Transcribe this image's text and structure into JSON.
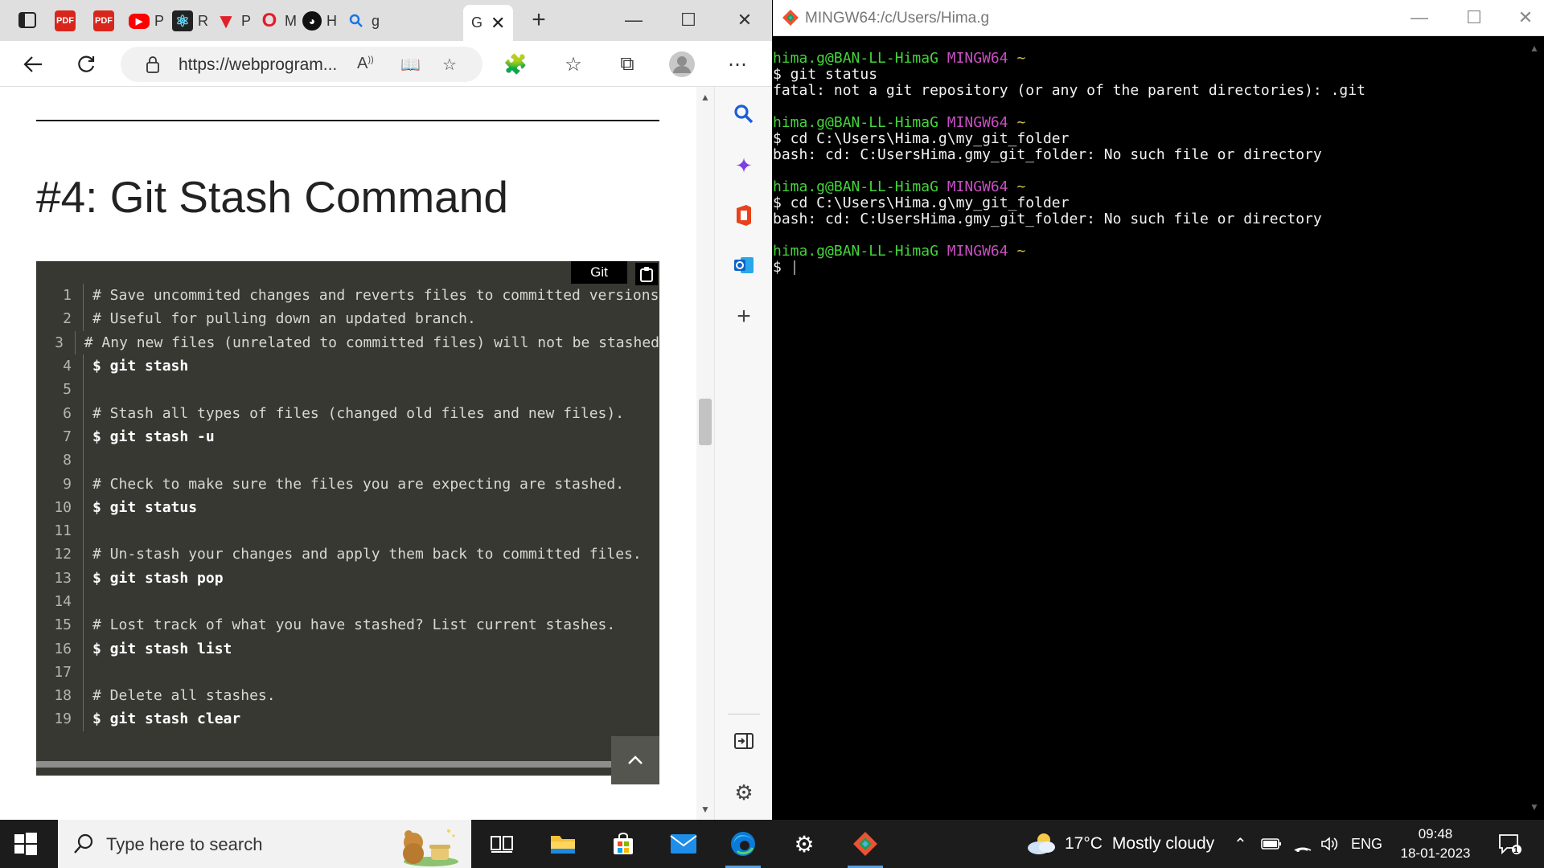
{
  "browser": {
    "tabs": [
      {
        "label": "P",
        "icon": "pdf-icon"
      },
      {
        "label": "P",
        "icon": "youtube-icon"
      },
      {
        "label": "R",
        "icon": "react-icon"
      },
      {
        "label": "P",
        "icon": "v-icon"
      },
      {
        "label": "M",
        "icon": "opera-icon"
      },
      {
        "label": "H",
        "icon": "github-icon"
      },
      {
        "label": "g",
        "icon": "search-icon"
      },
      {
        "label": "G",
        "icon": "page-icon"
      }
    ],
    "url": "https://webprogram...",
    "heading": "#4: Git Stash Command",
    "code_lang": "Git",
    "code_lines": [
      {
        "n": "1",
        "text": "# Save uncommited changes and reverts files to committed versions",
        "cmd": false
      },
      {
        "n": "2",
        "text": "# Useful for pulling down an updated branch.",
        "cmd": false
      },
      {
        "n": "3",
        "text": "# Any new files (unrelated to committed files) will not be stashed",
        "cmd": false
      },
      {
        "n": "4",
        "text": "$ git stash",
        "cmd": true
      },
      {
        "n": "5",
        "text": "",
        "cmd": false
      },
      {
        "n": "6",
        "text": "# Stash all types of files (changed old files and new files).",
        "cmd": false
      },
      {
        "n": "7",
        "text": "$ git stash -u",
        "cmd": true
      },
      {
        "n": "8",
        "text": "",
        "cmd": false
      },
      {
        "n": "9",
        "text": "# Check to make sure the files you are expecting are stashed.",
        "cmd": false
      },
      {
        "n": "10",
        "text": "$ git status",
        "cmd": true
      },
      {
        "n": "11",
        "text": "",
        "cmd": false
      },
      {
        "n": "12",
        "text": "# Un-stash your changes and apply them back to committed files.",
        "cmd": false
      },
      {
        "n": "13",
        "text": "$ git stash pop",
        "cmd": true
      },
      {
        "n": "14",
        "text": "",
        "cmd": false
      },
      {
        "n": "15",
        "text": "# Lost track of what you have stashed? List current stashes.",
        "cmd": false
      },
      {
        "n": "16",
        "text": "$ git stash list",
        "cmd": true
      },
      {
        "n": "17",
        "text": "",
        "cmd": false
      },
      {
        "n": "18",
        "text": "# Delete all stashes.",
        "cmd": false
      },
      {
        "n": "19",
        "text": "$ git stash clear",
        "cmd": true
      }
    ]
  },
  "terminal": {
    "title": "MINGW64:/c/Users/Hima.g",
    "prompt_user": "hima.g@BAN-LL-HimaG",
    "prompt_host": "MINGW64",
    "prompt_dir": "~",
    "lines": [
      {
        "type": "prompt"
      },
      {
        "type": "text",
        "text": "$ git status"
      },
      {
        "type": "text",
        "text": "fatal: not a git repository (or any of the parent directories): .git"
      },
      {
        "type": "blank"
      },
      {
        "type": "prompt"
      },
      {
        "type": "text",
        "text": "$ cd C:\\Users\\Hima.g\\my_git_folder"
      },
      {
        "type": "text",
        "text": "bash: cd: C:UsersHima.gmy_git_folder: No such file or directory"
      },
      {
        "type": "blank"
      },
      {
        "type": "prompt"
      },
      {
        "type": "text",
        "text": "$ cd C:\\Users\\Hima.g\\my_git_folder"
      },
      {
        "type": "text",
        "text": "bash: cd: C:UsersHima.gmy_git_folder: No such file or directory"
      },
      {
        "type": "blank"
      },
      {
        "type": "prompt"
      },
      {
        "type": "cursor",
        "text": "$ "
      }
    ]
  },
  "taskbar": {
    "search_placeholder": "Type here to search",
    "weather_temp": "17°C",
    "weather_desc": "Mostly cloudy",
    "lang": "ENG",
    "time": "09:48",
    "date": "18-01-2023",
    "notification_count": "1"
  },
  "colors": {
    "code_bg": "#383833",
    "term_user": "#43d43a",
    "term_host": "#c74ec1",
    "term_tilde": "#d8c446"
  }
}
